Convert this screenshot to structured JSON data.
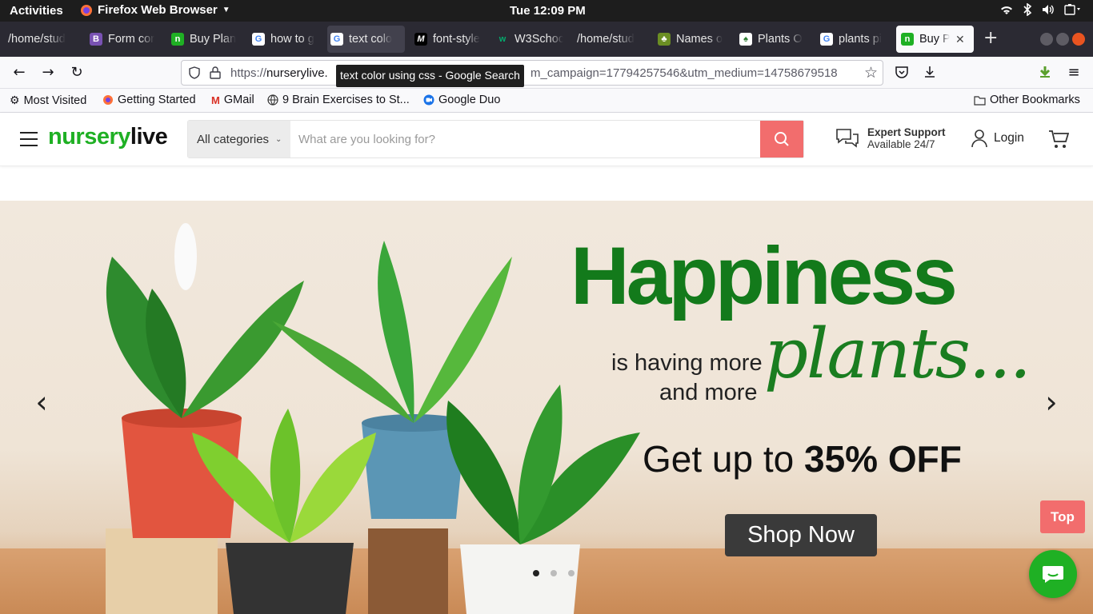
{
  "os": {
    "activities": "Activities",
    "app_name": "Firefox Web Browser",
    "clock": "Tue 12:09 PM"
  },
  "tabs": [
    {
      "label": "/home/stud",
      "favicon": "none",
      "state": "normal"
    },
    {
      "label": "Form cor",
      "favicon": "bootstrap-icon",
      "state": "normal"
    },
    {
      "label": "Buy Plan",
      "favicon": "nurserylive-icon",
      "state": "normal"
    },
    {
      "label": "how to g",
      "favicon": "google-icon",
      "state": "normal"
    },
    {
      "label": "text colo",
      "favicon": "google-icon",
      "state": "hover"
    },
    {
      "label": "font-style",
      "favicon": "medium-icon",
      "state": "normal"
    },
    {
      "label": "W3Schoo",
      "favicon": "w3schools-icon",
      "state": "normal"
    },
    {
      "label": "/home/stud",
      "favicon": "none",
      "state": "normal"
    },
    {
      "label": "Names o",
      "favicon": "tree-icon",
      "state": "normal"
    },
    {
      "label": "Plants O",
      "favicon": "plant-icon",
      "state": "normal"
    },
    {
      "label": "plants pi",
      "favicon": "google-icon",
      "state": "normal"
    },
    {
      "label": "Buy Pl",
      "favicon": "nurserylive-icon",
      "state": "active"
    }
  ],
  "navbar": {
    "url_prefix": "https://",
    "url_host": "nurserylive.",
    "url_rest": "m_campaign=17794257546&utm_medium=14758679518",
    "tooltip": "text color using css - Google Search"
  },
  "bookmarks": [
    {
      "label": "Most Visited",
      "icon": "gear-icon"
    },
    {
      "label": "Getting Started",
      "icon": "firefox-icon"
    },
    {
      "label": "GMail",
      "icon": "gmail-icon"
    },
    {
      "label": "9 Brain Exercises to St...",
      "icon": "globe-icon"
    },
    {
      "label": "Google Duo",
      "icon": "duo-icon"
    }
  ],
  "other_bookmarks": "Other Bookmarks",
  "site": {
    "logo_green": "nursery",
    "logo_dark": "live",
    "category": "All categories",
    "search_placeholder": "What are you looking for?",
    "support_title": "Expert Support",
    "support_sub": "Available 24/7",
    "login": "Login"
  },
  "hero": {
    "headline": "Happiness",
    "sub_line1": "is having more",
    "sub_line2": "and more",
    "script_word": "plants...",
    "offer_prefix": "Get up to ",
    "offer_bold": "35% OFF",
    "cta": "Shop Now",
    "slide_index": 1,
    "slide_count": 3
  },
  "top_button": "Top",
  "colors": {
    "brand_green": "#1fb024",
    "accent_red": "#f26d6d",
    "headline_green": "#137a1b"
  }
}
